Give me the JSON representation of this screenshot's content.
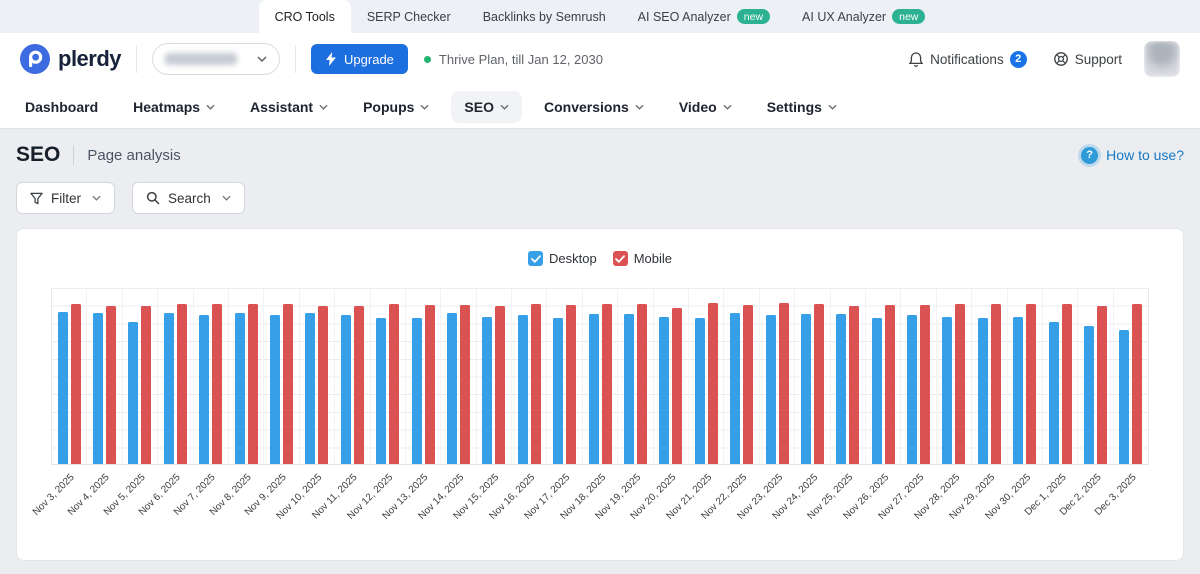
{
  "topbar": {
    "tabs": [
      {
        "label": "CRO Tools",
        "active": true,
        "badge": ""
      },
      {
        "label": "SERP Checker",
        "active": false,
        "badge": ""
      },
      {
        "label": "Backlinks by Semrush",
        "active": false,
        "badge": ""
      },
      {
        "label": "AI SEO Analyzer",
        "active": false,
        "badge": "new"
      },
      {
        "label": "AI UX Analyzer",
        "active": false,
        "badge": "new"
      }
    ]
  },
  "header": {
    "brand": "plerdy",
    "account_selector_blurred": true,
    "upgrade_button": "Upgrade",
    "plan_status": "Thrive Plan, till Jan 12, 2030",
    "notifications": {
      "label": "Notifications",
      "count": "2"
    },
    "support_label": "Support"
  },
  "nav": {
    "items": [
      {
        "label": "Dashboard",
        "chevron": false,
        "active": false
      },
      {
        "label": "Heatmaps",
        "chevron": true,
        "active": false
      },
      {
        "label": "Assistant",
        "chevron": true,
        "active": false
      },
      {
        "label": "Popups",
        "chevron": true,
        "active": false
      },
      {
        "label": "SEO",
        "chevron": true,
        "active": true
      },
      {
        "label": "Conversions",
        "chevron": true,
        "active": false
      },
      {
        "label": "Video",
        "chevron": true,
        "active": false
      },
      {
        "label": "Settings",
        "chevron": true,
        "active": false
      }
    ]
  },
  "page": {
    "title": "SEO",
    "subtitle": "Page analysis",
    "help_link": "How to use?"
  },
  "toolbar": {
    "filter": "Filter",
    "search": "Search"
  },
  "chart_data": {
    "type": "bar",
    "title": "",
    "categories": [
      "Nov 3, 2025",
      "Nov 4, 2025",
      "Nov 5, 2025",
      "Nov 6, 2025",
      "Nov 7, 2025",
      "Nov 8, 2025",
      "Nov 9, 2025",
      "Nov 10, 2025",
      "Nov 11, 2025",
      "Nov 12, 2025",
      "Nov 13, 2025",
      "Nov 14, 2025",
      "Nov 15, 2025",
      "Nov 16, 2025",
      "Nov 17, 2025",
      "Nov 18, 2025",
      "Nov 19, 2025",
      "Nov 20, 2025",
      "Nov 21, 2025",
      "Nov 22, 2025",
      "Nov 23, 2025",
      "Nov 24, 2025",
      "Nov 25, 2025",
      "Nov 26, 2025",
      "Nov 27, 2025",
      "Nov 28, 2025",
      "Nov 29, 2025",
      "Nov 30, 2025",
      "Dec 1, 2025",
      "Dec 2, 2025",
      "Dec 3, 2025"
    ],
    "series": [
      {
        "name": "Desktop",
        "color": "#369fe8",
        "checked": true,
        "values": [
          95,
          94.5,
          89,
          94.5,
          93,
          94.5,
          93,
          94.5,
          93,
          91,
          91,
          94.5,
          92,
          93,
          91,
          94,
          94,
          92,
          91,
          94.5,
          93,
          94,
          94,
          91,
          93,
          92,
          91,
          92,
          89,
          86.5,
          84
        ]
      },
      {
        "name": "Mobile",
        "color": "#da5352",
        "checked": true,
        "values": [
          100,
          99,
          99,
          100,
          100,
          100,
          100,
          99,
          99,
          100,
          99.5,
          99.5,
          99,
          100,
          99.5,
          100,
          100,
          97.5,
          100.5,
          99.5,
          100.5,
          100,
          99,
          99.5,
          99.5,
          100,
          100,
          100,
          100,
          99,
          100
        ]
      }
    ],
    "ylim": [
      0,
      110
    ],
    "y_axis_tick_labels": "none visible (relative units)",
    "legend_position": "top-center",
    "grid": {
      "horizontal": true,
      "vertical_category_separators": true
    }
  },
  "colors": {
    "accent_blue": "#1d6fe0",
    "notification_badge_blue": "#1a73e8",
    "new_badge_green": "#2cb293",
    "plan_dot_green": "#21b573",
    "desktop_bar": "#369fe8",
    "mobile_bar": "#da5352",
    "link_blue": "#1779c4",
    "topbar_bg": "#edf0f5",
    "content_bg": "#ebedf0"
  }
}
